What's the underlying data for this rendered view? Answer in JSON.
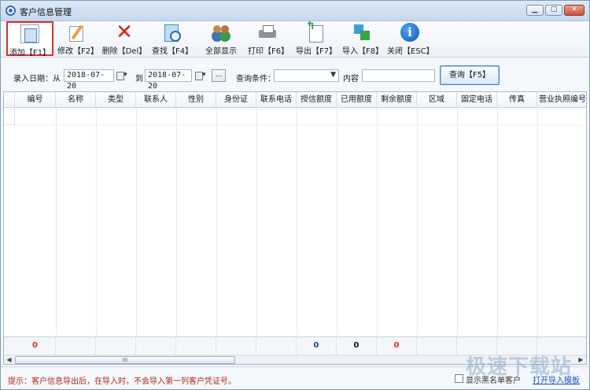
{
  "window": {
    "title": "客户信息管理",
    "controls": {
      "minimize": "▁",
      "maximize": "▢",
      "close": "✕"
    }
  },
  "toolbar": {
    "items": [
      {
        "label": "添加【F1】",
        "icon": "add-icon"
      },
      {
        "label": "修改【F2】",
        "icon": "edit-icon"
      },
      {
        "label": "删除【Del】",
        "icon": "delete-icon"
      },
      {
        "label": "查找【F4】",
        "icon": "find-icon"
      },
      {
        "label": "全部显示",
        "icon": "users-icon"
      },
      {
        "label": "打印【F6】",
        "icon": "printer-icon"
      },
      {
        "label": "导出【F7】",
        "icon": "export-icon"
      },
      {
        "label": "导入【F8】",
        "icon": "import-icon"
      },
      {
        "label": "关闭【ESC】",
        "icon": "info-icon"
      }
    ],
    "delete_glyph": "✕",
    "close_glyph": "i"
  },
  "filter": {
    "entry_date_label": "录入日期：从",
    "date_from": "2018-07-20",
    "to_label": "到",
    "date_to": "2018-07-20",
    "more_button": "...",
    "condition_label": "查询条件：",
    "condition_value": "",
    "content_label": "内容",
    "content_value": "",
    "query_button": "查询【F5】"
  },
  "grid": {
    "columns": [
      "编号",
      "名称",
      "类型",
      "联系人",
      "性别",
      "身份证",
      "联系电话",
      "授信额度",
      "已用额度",
      "剩余额度",
      "区域",
      "固定电话",
      "传真",
      "营业执照编号"
    ],
    "totals": {
      "count": "0",
      "credit_limit": "0",
      "used_limit": "0",
      "remaining_limit": "0"
    },
    "totals_colors": {
      "count": "#d9302b",
      "credit_limit": "#1c3fb0",
      "used_limit": "#111111",
      "remaining_limit": "#d9302b"
    },
    "scroll_thumb": "III"
  },
  "status": {
    "tip": "提示：客户信息导出后，在导入时，不会导入第一列客户凭证号。",
    "checkbox_label": "显示黑名单客户",
    "link": "打开导入模板"
  },
  "watermark": "极速下载站"
}
